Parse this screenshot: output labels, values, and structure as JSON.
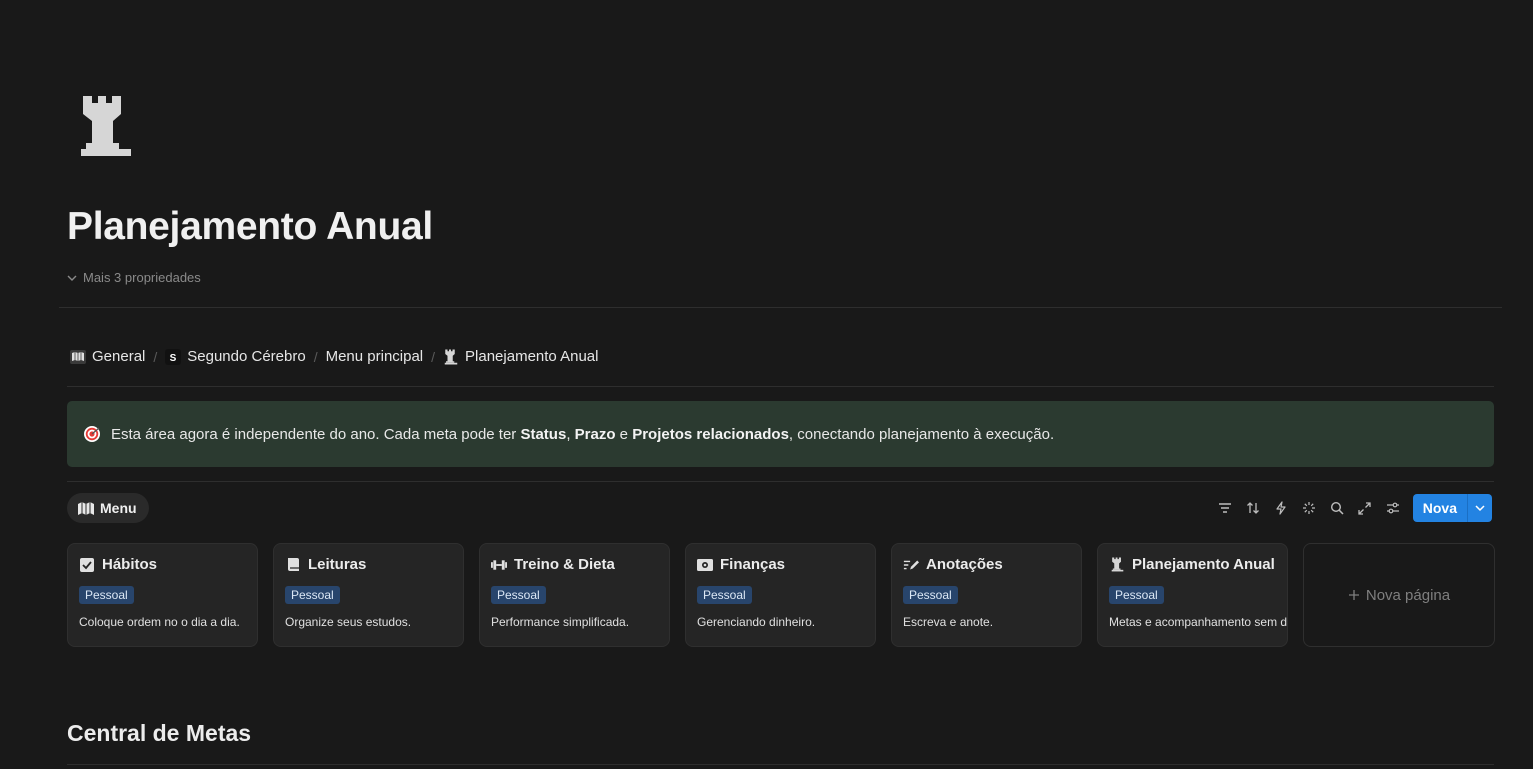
{
  "page": {
    "icon": "chess-rook-icon",
    "title": "Planejamento Anual",
    "properties_toggle": "Mais 3 propriedades"
  },
  "breadcrumb": [
    {
      "icon": "map-icon",
      "label": "General"
    },
    {
      "icon": "s-logo-icon",
      "label": "Segundo Cérebro"
    },
    {
      "icon": "",
      "label": "Menu principal"
    },
    {
      "icon": "chess-rook-icon",
      "label": "Planejamento Anual"
    }
  ],
  "callout": {
    "icon": "target-icon",
    "text_1": "Esta área agora é independente do ano. Cada meta pode ter ",
    "bold_1": "Status",
    "text_2": ", ",
    "bold_2": "Prazo",
    "text_3": " e ",
    "bold_3": "Projetos relacionados",
    "text_4": ", conectando planejamento à execução.",
    "background": "#2b3a30"
  },
  "view": {
    "tab_label": "Menu",
    "toolbar": {
      "icons": [
        "filter-icon",
        "sort-icon",
        "lightning-icon",
        "sparkle-icon",
        "search-icon",
        "expand-icon",
        "settings-sliders-icon"
      ],
      "new_label": "Nova",
      "accent": "#2383e2"
    }
  },
  "cards": [
    {
      "icon": "checkbox-icon",
      "title": "Hábitos",
      "tag": "Pessoal",
      "desc": "Coloque ordem no o dia a dia."
    },
    {
      "icon": "book-icon",
      "title": "Leituras",
      "tag": "Pessoal",
      "desc": "Organize seus estudos."
    },
    {
      "icon": "dumbbell-icon",
      "title": "Treino & Dieta",
      "tag": "Pessoal",
      "desc": "Performance simplificada."
    },
    {
      "icon": "money-icon",
      "title": "Finanças",
      "tag": "Pessoal",
      "desc": "Gerenciando dinheiro."
    },
    {
      "icon": "note-pen-icon",
      "title": "Anotações",
      "tag": "Pessoal",
      "desc": "Escreva e anote."
    },
    {
      "icon": "chess-rook-icon",
      "title": "Planejamento Anual",
      "tag": "Pessoal",
      "desc": "Metas e acompanhamento sem de"
    }
  ],
  "new_page_label": "Nova página",
  "section_heading": "Central de Metas"
}
